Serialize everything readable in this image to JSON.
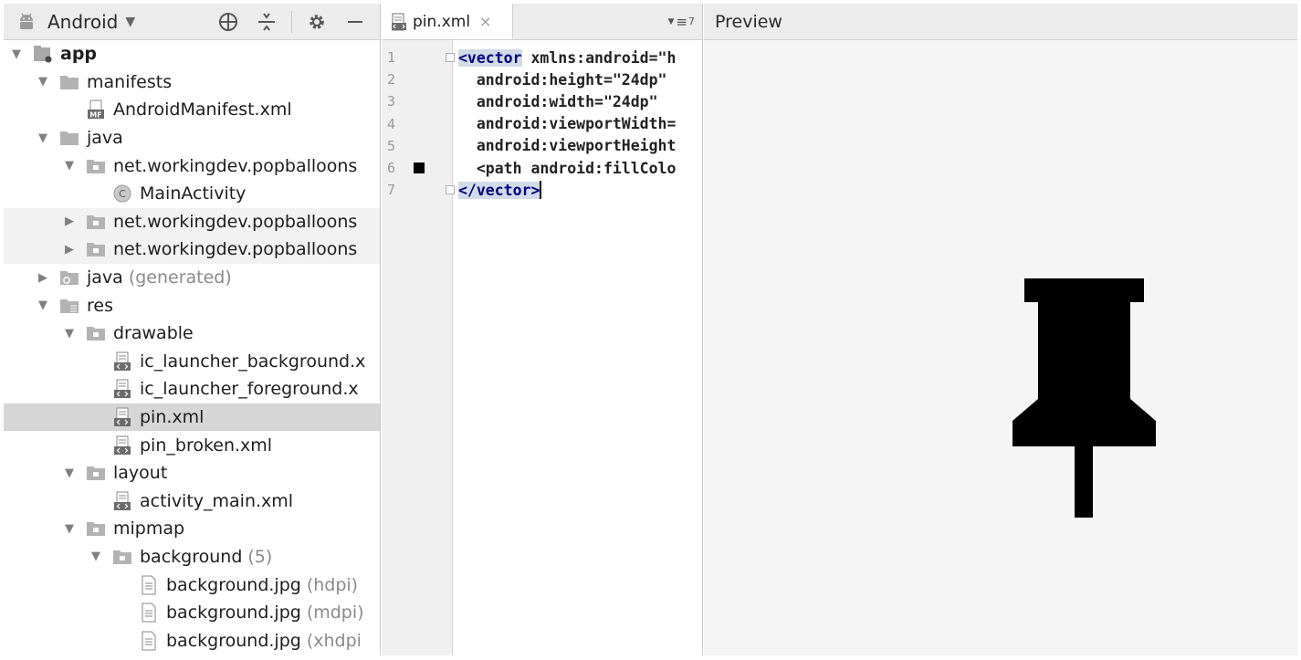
{
  "project": {
    "view_name": "Android",
    "tree": [
      {
        "label": "app",
        "depth": 0,
        "arrow": "down",
        "icon": "module-icon",
        "bold": true
      },
      {
        "label": "manifests",
        "depth": 1,
        "arrow": "down",
        "icon": "folder-icon"
      },
      {
        "label": "AndroidManifest.xml",
        "depth": 2,
        "arrow": "none",
        "icon": "manifest-file-icon"
      },
      {
        "label": "java",
        "depth": 1,
        "arrow": "down",
        "icon": "folder-icon"
      },
      {
        "label": "net.workingdev.popballoons",
        "depth": 2,
        "arrow": "down",
        "icon": "package-icon"
      },
      {
        "label": "MainActivity",
        "depth": 3,
        "arrow": "none",
        "icon": "class-icon"
      },
      {
        "label": "net.workingdev.popballoons",
        "depth": 2,
        "arrow": "right",
        "icon": "package-icon",
        "shaded": true
      },
      {
        "label": "net.workingdev.popballoons",
        "depth": 2,
        "arrow": "right",
        "icon": "package-icon",
        "shaded": true
      },
      {
        "label": "java",
        "suffix": "(generated)",
        "depth": 1,
        "arrow": "right",
        "icon": "generated-folder-icon"
      },
      {
        "label": "res",
        "depth": 1,
        "arrow": "down",
        "icon": "res-folder-icon"
      },
      {
        "label": "drawable",
        "depth": 2,
        "arrow": "down",
        "icon": "package-icon"
      },
      {
        "label": "ic_launcher_background.x",
        "depth": 3,
        "arrow": "none",
        "icon": "xml-file-icon"
      },
      {
        "label": "ic_launcher_foreground.x",
        "depth": 3,
        "arrow": "none",
        "icon": "xml-file-icon"
      },
      {
        "label": "pin.xml",
        "depth": 3,
        "arrow": "none",
        "icon": "xml-file-icon",
        "selected": true
      },
      {
        "label": "pin_broken.xml",
        "depth": 3,
        "arrow": "none",
        "icon": "xml-file-icon"
      },
      {
        "label": "layout",
        "depth": 2,
        "arrow": "down",
        "icon": "package-icon"
      },
      {
        "label": "activity_main.xml",
        "depth": 3,
        "arrow": "none",
        "icon": "xml-file-icon"
      },
      {
        "label": "mipmap",
        "depth": 2,
        "arrow": "down",
        "icon": "package-icon"
      },
      {
        "label": "background",
        "suffix": "(5)",
        "depth": 3,
        "arrow": "down",
        "icon": "package-icon"
      },
      {
        "label": "background.jpg",
        "suffix": "(hdpi)",
        "depth": 4,
        "arrow": "none",
        "icon": "image-file-icon"
      },
      {
        "label": "background.jpg",
        "suffix": "(mdpi)",
        "depth": 4,
        "arrow": "none",
        "icon": "image-file-icon"
      },
      {
        "label": "background.jpg",
        "suffix": "(xhdpi",
        "depth": 4,
        "arrow": "none",
        "icon": "image-file-icon"
      }
    ]
  },
  "editor": {
    "tab_label": "pin.xml",
    "tab_close": "×",
    "recent_count": "7",
    "line_numbers": [
      "1",
      "2",
      "3",
      "4",
      "5",
      "6",
      "7"
    ],
    "code": [
      {
        "tag": "<vector",
        "rest": " xmlns:android=\"h"
      },
      {
        "tag": "",
        "rest": "  android:height=\"24dp\""
      },
      {
        "tag": "",
        "rest": "  android:width=\"24dp\""
      },
      {
        "tag": "",
        "rest": "  android:viewportWidth="
      },
      {
        "tag": "",
        "rest": "  android:viewportHeight"
      },
      {
        "tag": "",
        "rest": "  <path android:fillColo"
      },
      {
        "tag": "</vector>",
        "rest": ""
      }
    ],
    "swatch_color": "#000000"
  },
  "preview": {
    "title": "Preview",
    "icon": "pushpin-icon",
    "fill": "#000000"
  }
}
